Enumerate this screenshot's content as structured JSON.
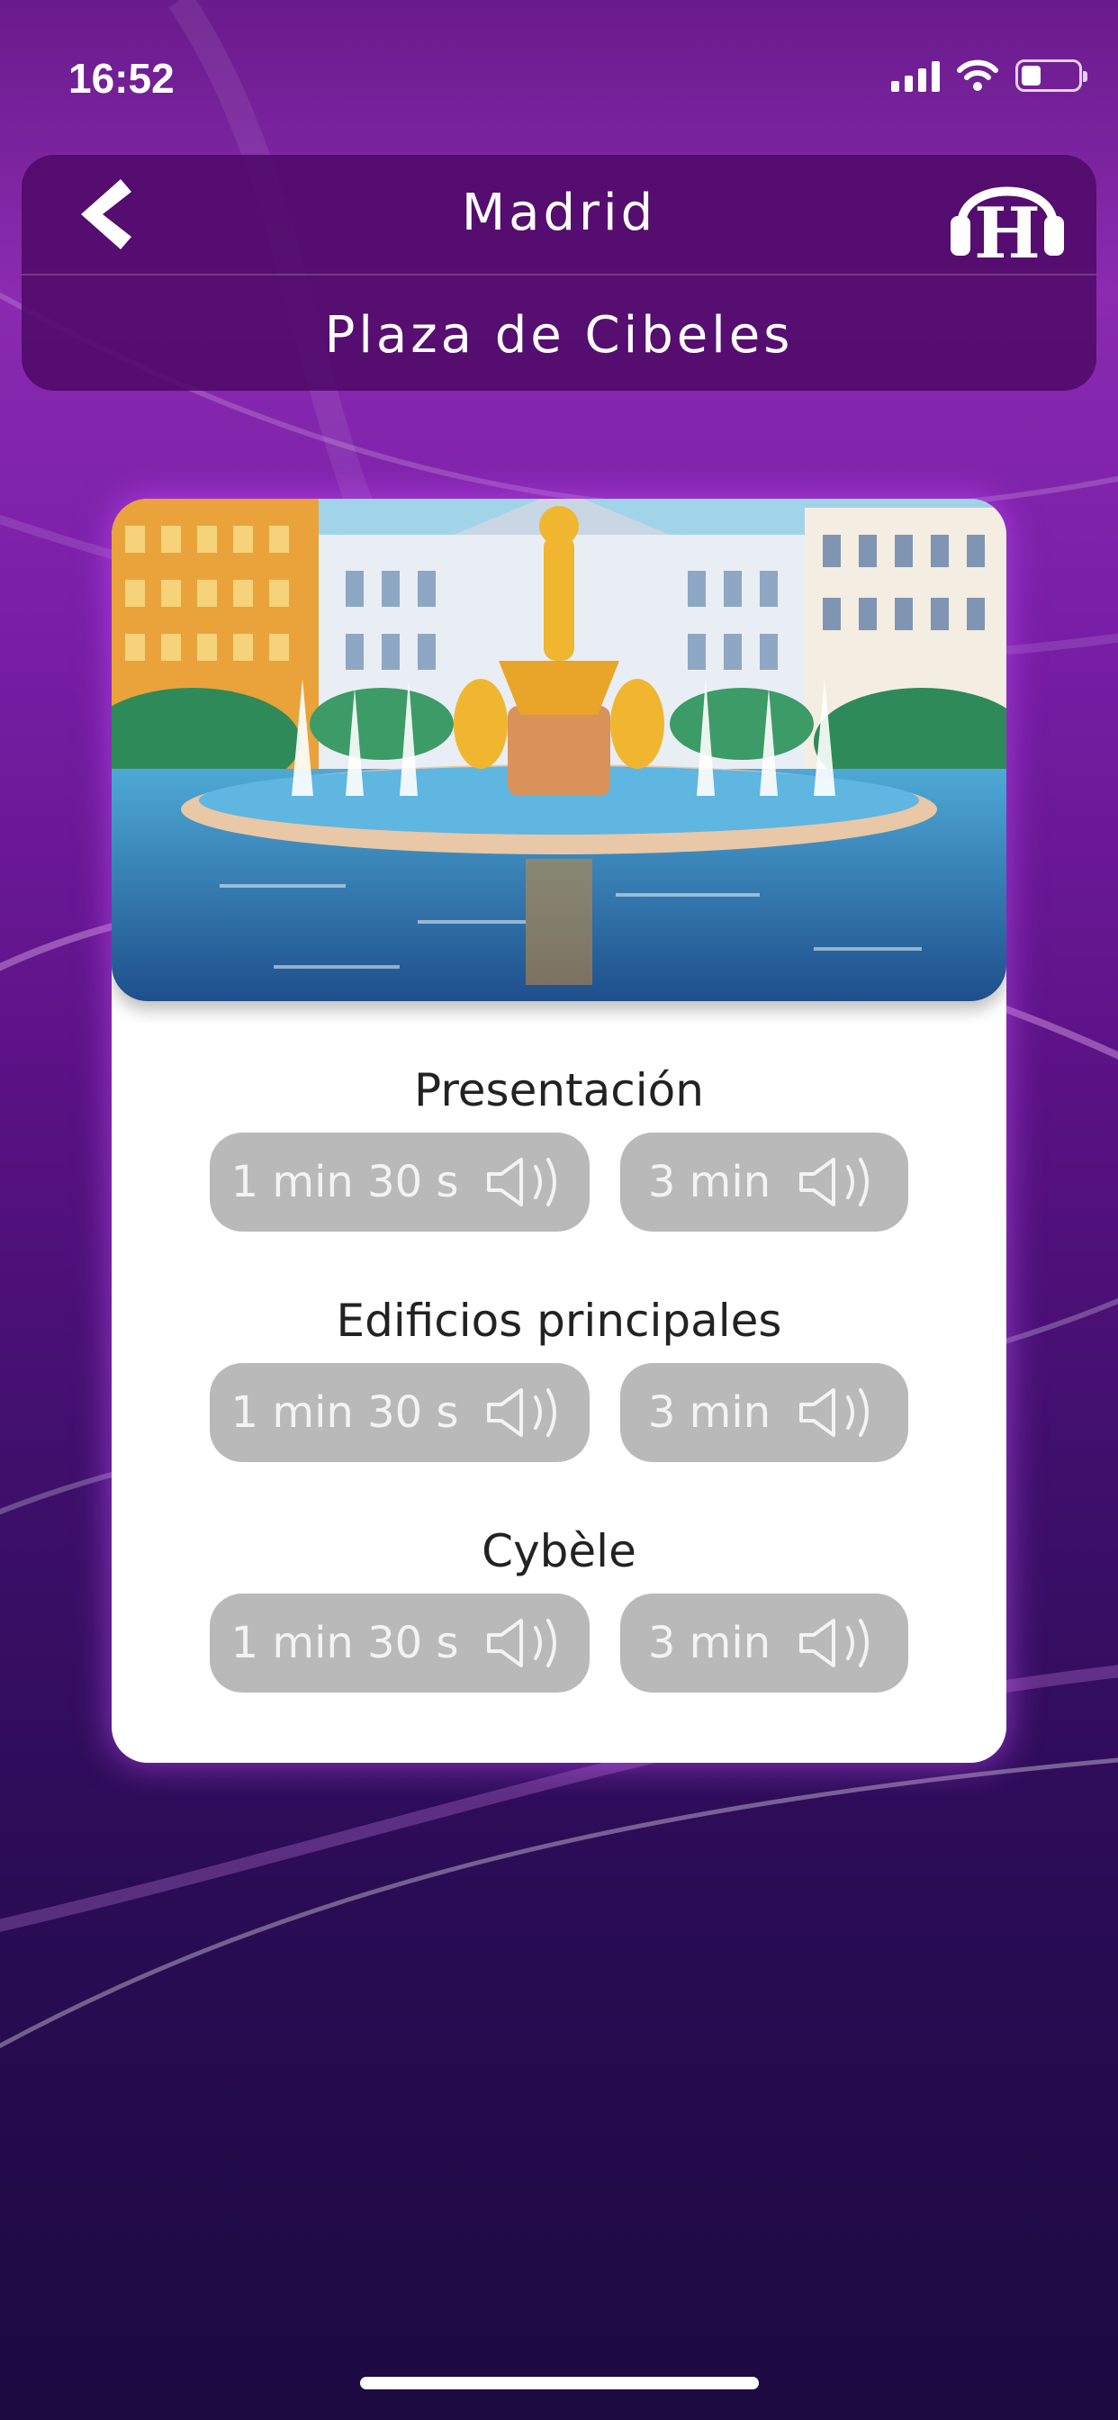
{
  "status_bar": {
    "time": "16:52",
    "battery_level": 0.35
  },
  "header": {
    "city": "Madrid",
    "place": "Plaza de Cibeles",
    "back_icon": "chevron-left-icon",
    "logo_icon": "headphones-h-logo",
    "logo_letter": "H"
  },
  "sections": [
    {
      "title": "Presentación",
      "options": [
        {
          "label": "1 min 30 s",
          "icon": "speaker-icon"
        },
        {
          "label": "3 min",
          "icon": "speaker-icon"
        }
      ]
    },
    {
      "title": "Edificios principales",
      "options": [
        {
          "label": "1 min 30 s",
          "icon": "speaker-icon"
        },
        {
          "label": "3 min",
          "icon": "speaker-icon"
        }
      ]
    },
    {
      "title": "Cybèle",
      "options": [
        {
          "label": "1 min 30 s",
          "icon": "speaker-icon"
        },
        {
          "label": "3 min",
          "icon": "speaker-icon"
        }
      ]
    }
  ],
  "colors": {
    "header_bg": "#4e0a68",
    "pill_bg": "#b9b9b9",
    "pill_text": "#f3f3f3",
    "card_bg": "#ffffff",
    "title_text": "#222222"
  }
}
